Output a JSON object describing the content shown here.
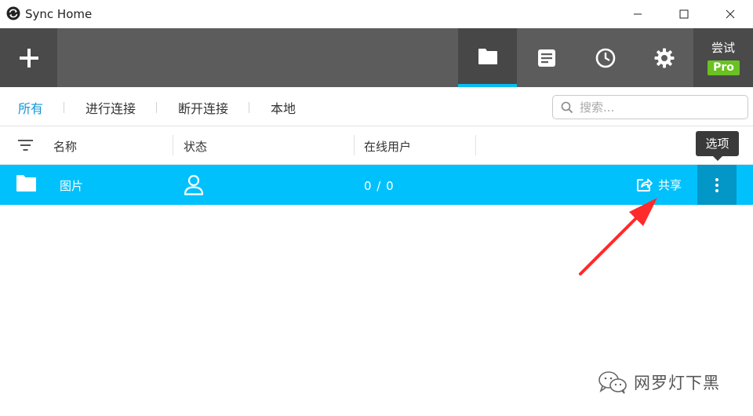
{
  "window": {
    "title": "Sync Home"
  },
  "toolbar": {
    "add_icon": "plus-icon",
    "tools": [
      {
        "icon": "folder-icon",
        "active": true
      },
      {
        "icon": "document-icon",
        "active": false
      },
      {
        "icon": "clock-icon",
        "active": false
      },
      {
        "icon": "gear-icon",
        "active": false
      }
    ],
    "user": {
      "name": "尝试",
      "badge": "Pro"
    }
  },
  "filters": {
    "tabs": [
      "所有",
      "进行连接",
      "断开连接",
      "本地"
    ],
    "active_index": 0,
    "search_placeholder": "搜索..."
  },
  "columns": {
    "name": "名称",
    "status": "状态",
    "online_users": "在线用户"
  },
  "rows": [
    {
      "name": "图片",
      "online": "0 / 0",
      "share_label": "共享"
    }
  ],
  "tooltip": {
    "text": "选项"
  },
  "watermark": {
    "text": "网罗灯下黑"
  },
  "colors": {
    "accent": "#00c1fc",
    "toolbar": "#5c5c5c",
    "active_tab_text": "#1496d6",
    "pro_badge": "#6ac122",
    "annotation": "#ff2a2a"
  }
}
